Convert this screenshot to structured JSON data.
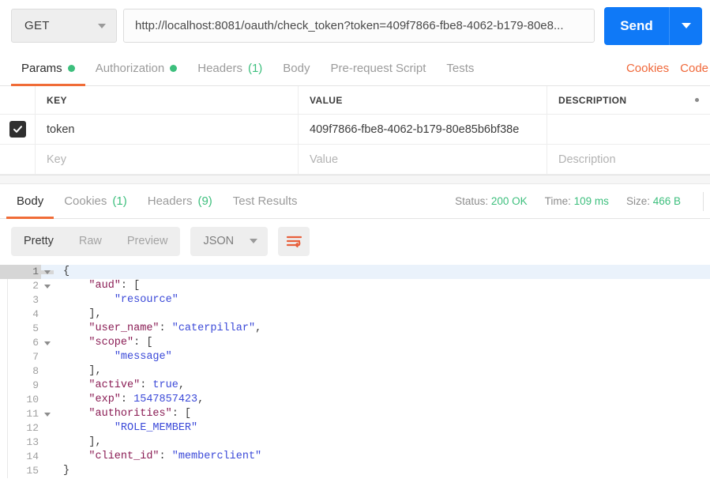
{
  "request": {
    "method": "GET",
    "url": "http://localhost:8081/oauth/check_token?token=409f7866-fbe8-4062-b179-80e8...",
    "send_label": "Send",
    "tabs": [
      {
        "label": "Params",
        "badge": "",
        "badge_type": "dot",
        "active": true
      },
      {
        "label": "Authorization",
        "badge": "",
        "badge_type": "dot",
        "active": false
      },
      {
        "label": "Headers",
        "badge": "(1)",
        "badge_type": "count",
        "active": false
      },
      {
        "label": "Body",
        "badge": "",
        "badge_type": "none",
        "active": false
      },
      {
        "label": "Pre-request Script",
        "badge": "",
        "badge_type": "none",
        "active": false
      },
      {
        "label": "Tests",
        "badge": "",
        "badge_type": "none",
        "active": false
      }
    ],
    "right_links": [
      {
        "label": "Cookies"
      },
      {
        "label": "Code"
      }
    ]
  },
  "params_table": {
    "headers": [
      "KEY",
      "VALUE",
      "DESCRIPTION"
    ],
    "rows": [
      {
        "checked": true,
        "key": "token",
        "value": "409f7866-fbe8-4062-b179-80e85b6bf38e",
        "description": ""
      }
    ],
    "placeholders": {
      "key": "Key",
      "value": "Value",
      "description": "Description"
    }
  },
  "response": {
    "tabs": [
      {
        "label": "Body",
        "badge": "",
        "active": true
      },
      {
        "label": "Cookies",
        "badge": "(1)",
        "active": false
      },
      {
        "label": "Headers",
        "badge": "(9)",
        "active": false
      },
      {
        "label": "Test Results",
        "badge": "",
        "active": false
      }
    ],
    "status_label": "Status:",
    "status_value": "200 OK",
    "time_label": "Time:",
    "time_value": "109 ms",
    "size_label": "Size:",
    "size_value": "466 B",
    "view_modes": [
      {
        "label": "Pretty",
        "active": true
      },
      {
        "label": "Raw",
        "active": false
      },
      {
        "label": "Preview",
        "active": false
      }
    ],
    "format": "JSON",
    "wrap_icon": "word-wrap-icon"
  },
  "code_lines": [
    {
      "n": 1,
      "fold": true,
      "active": true,
      "parts": [
        {
          "t": "{",
          "c": "p"
        }
      ]
    },
    {
      "n": 2,
      "fold": true,
      "active": false,
      "parts": [
        {
          "t": "    ",
          "c": "p"
        },
        {
          "t": "\"aud\"",
          "c": "k"
        },
        {
          "t": ": [",
          "c": "p"
        }
      ]
    },
    {
      "n": 3,
      "fold": false,
      "active": false,
      "parts": [
        {
          "t": "        ",
          "c": "p"
        },
        {
          "t": "\"resource\"",
          "c": "s"
        }
      ]
    },
    {
      "n": 4,
      "fold": false,
      "active": false,
      "parts": [
        {
          "t": "    ],",
          "c": "p"
        }
      ]
    },
    {
      "n": 5,
      "fold": false,
      "active": false,
      "parts": [
        {
          "t": "    ",
          "c": "p"
        },
        {
          "t": "\"user_name\"",
          "c": "k"
        },
        {
          "t": ": ",
          "c": "p"
        },
        {
          "t": "\"caterpillar\"",
          "c": "s"
        },
        {
          "t": ",",
          "c": "p"
        }
      ]
    },
    {
      "n": 6,
      "fold": true,
      "active": false,
      "parts": [
        {
          "t": "    ",
          "c": "p"
        },
        {
          "t": "\"scope\"",
          "c": "k"
        },
        {
          "t": ": [",
          "c": "p"
        }
      ]
    },
    {
      "n": 7,
      "fold": false,
      "active": false,
      "parts": [
        {
          "t": "        ",
          "c": "p"
        },
        {
          "t": "\"message\"",
          "c": "s"
        }
      ]
    },
    {
      "n": 8,
      "fold": false,
      "active": false,
      "parts": [
        {
          "t": "    ],",
          "c": "p"
        }
      ]
    },
    {
      "n": 9,
      "fold": false,
      "active": false,
      "parts": [
        {
          "t": "    ",
          "c": "p"
        },
        {
          "t": "\"active\"",
          "c": "k"
        },
        {
          "t": ": ",
          "c": "p"
        },
        {
          "t": "true",
          "c": "b"
        },
        {
          "t": ",",
          "c": "p"
        }
      ]
    },
    {
      "n": 10,
      "fold": false,
      "active": false,
      "parts": [
        {
          "t": "    ",
          "c": "p"
        },
        {
          "t": "\"exp\"",
          "c": "k"
        },
        {
          "t": ": ",
          "c": "p"
        },
        {
          "t": "1547857423",
          "c": "n"
        },
        {
          "t": ",",
          "c": "p"
        }
      ]
    },
    {
      "n": 11,
      "fold": true,
      "active": false,
      "parts": [
        {
          "t": "    ",
          "c": "p"
        },
        {
          "t": "\"authorities\"",
          "c": "k"
        },
        {
          "t": ": [",
          "c": "p"
        }
      ]
    },
    {
      "n": 12,
      "fold": false,
      "active": false,
      "parts": [
        {
          "t": "        ",
          "c": "p"
        },
        {
          "t": "\"ROLE_MEMBER\"",
          "c": "s"
        }
      ]
    },
    {
      "n": 13,
      "fold": false,
      "active": false,
      "parts": [
        {
          "t": "    ],",
          "c": "p"
        }
      ]
    },
    {
      "n": 14,
      "fold": false,
      "active": false,
      "parts": [
        {
          "t": "    ",
          "c": "p"
        },
        {
          "t": "\"client_id\"",
          "c": "k"
        },
        {
          "t": ": ",
          "c": "p"
        },
        {
          "t": "\"memberclient\"",
          "c": "s"
        }
      ]
    },
    {
      "n": 15,
      "fold": false,
      "active": false,
      "parts": [
        {
          "t": "}",
          "c": "p"
        }
      ]
    }
  ],
  "colors": {
    "accent_orange": "#f06c37",
    "send_blue": "#0f79f7",
    "status_green": "#3dbf7d",
    "json_key": "#8a1c54",
    "json_string": "#3b49d8"
  }
}
